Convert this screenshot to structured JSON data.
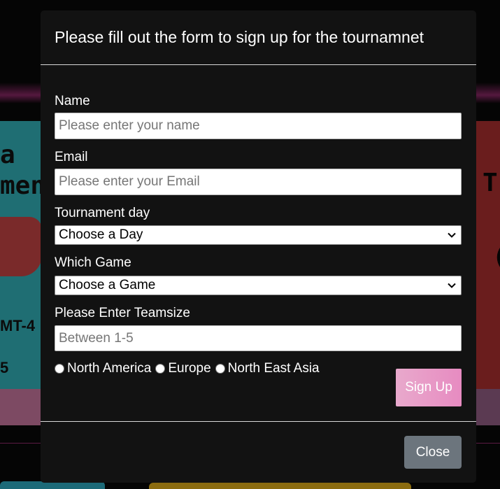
{
  "modal": {
    "title": "Please fill out the form to sign up for the tournamnet"
  },
  "form": {
    "name": {
      "label": "Name",
      "placeholder": "Please enter your name",
      "value": ""
    },
    "email": {
      "label": "Email",
      "placeholder": "Please enter your Email",
      "value": ""
    },
    "day": {
      "label": "Tournament day",
      "selected": "Choose a Day"
    },
    "game": {
      "label": "Which Game",
      "selected": "Choose a Game"
    },
    "teamsize": {
      "label": "Please Enter Teamsize",
      "placeholder": "Between 1-5",
      "value": ""
    },
    "regions": [
      "North America",
      "Europe",
      "North East Asia"
    ],
    "submit_label": "Sign Up"
  },
  "footer": {
    "close_label": "Close"
  },
  "background": {
    "left_text_1": "a",
    "left_text_2": "men",
    "left_text_3": "MT-4",
    "left_text_4": "5",
    "right_text_1": "T",
    "right_text_2": "("
  },
  "colors": {
    "modal_bg": "#121212",
    "signup_gradient_start": "#e8a9cc",
    "signup_gradient_end": "#e78bc1",
    "close_bg": "#6c757d"
  },
  "icons": {
    "select_chevron": "chevron-down-icon"
  }
}
